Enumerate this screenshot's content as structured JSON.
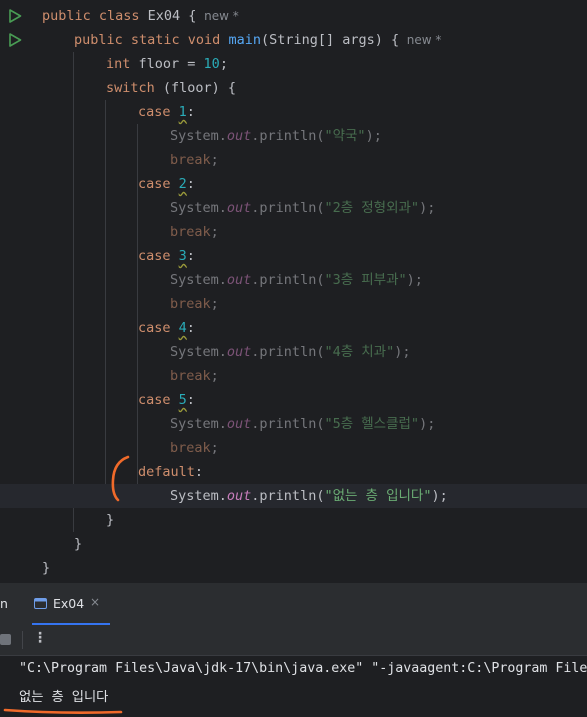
{
  "editor": {
    "lines": [
      {
        "segments": [
          {
            "t": "public class ",
            "c": "kw"
          },
          {
            "t": "Ex04 {"
          },
          {
            "t": "  new *",
            "c": "ph"
          }
        ]
      },
      {
        "segments": [
          {
            "t": "public static void ",
            "c": "kw"
          },
          {
            "t": "main",
            "c": "fn"
          },
          {
            "t": "(String[] args) {"
          },
          {
            "t": "  new *",
            "c": "ph"
          }
        ]
      },
      {
        "segments": [
          {
            "t": "int ",
            "c": "kw"
          },
          {
            "t": "floor = "
          },
          {
            "t": "10",
            "c": "num"
          },
          {
            "t": ";"
          }
        ]
      },
      {
        "segments": [
          {
            "t": "switch ",
            "c": "kw"
          },
          {
            "t": "(floor) {"
          }
        ]
      },
      {
        "segments": [
          {
            "t": "case ",
            "c": "kw"
          },
          {
            "t": "1",
            "c": "num squiggle"
          },
          {
            "t": ":"
          }
        ]
      },
      {
        "dim": true,
        "segments": [
          {
            "t": "System."
          },
          {
            "t": "out",
            "c": "fld"
          },
          {
            "t": ".println("
          },
          {
            "t": "\"약국\"",
            "c": "str"
          },
          {
            "t": ");"
          }
        ]
      },
      {
        "dim": true,
        "segments": [
          {
            "t": "break",
            "c": "kw"
          },
          {
            "t": ";"
          }
        ]
      },
      {
        "segments": [
          {
            "t": "case ",
            "c": "kw"
          },
          {
            "t": "2",
            "c": "num squiggle"
          },
          {
            "t": ":"
          }
        ]
      },
      {
        "dim": true,
        "segments": [
          {
            "t": "System."
          },
          {
            "t": "out",
            "c": "fld"
          },
          {
            "t": ".println("
          },
          {
            "t": "\"2층 정형외과\"",
            "c": "str"
          },
          {
            "t": ");"
          }
        ]
      },
      {
        "dim": true,
        "segments": [
          {
            "t": "break",
            "c": "kw"
          },
          {
            "t": ";"
          }
        ]
      },
      {
        "segments": [
          {
            "t": "case ",
            "c": "kw"
          },
          {
            "t": "3",
            "c": "num squiggle"
          },
          {
            "t": ":"
          }
        ]
      },
      {
        "dim": true,
        "segments": [
          {
            "t": "System."
          },
          {
            "t": "out",
            "c": "fld"
          },
          {
            "t": ".println("
          },
          {
            "t": "\"3층 피부과\"",
            "c": "str"
          },
          {
            "t": ");"
          }
        ]
      },
      {
        "dim": true,
        "segments": [
          {
            "t": "break",
            "c": "kw"
          },
          {
            "t": ";"
          }
        ]
      },
      {
        "segments": [
          {
            "t": "case ",
            "c": "kw"
          },
          {
            "t": "4",
            "c": "num squiggle"
          },
          {
            "t": ":"
          }
        ]
      },
      {
        "dim": true,
        "segments": [
          {
            "t": "System."
          },
          {
            "t": "out",
            "c": "fld"
          },
          {
            "t": ".println("
          },
          {
            "t": "\"4층 치과\"",
            "c": "str"
          },
          {
            "t": ");"
          }
        ]
      },
      {
        "dim": true,
        "segments": [
          {
            "t": "break",
            "c": "kw"
          },
          {
            "t": ";"
          }
        ]
      },
      {
        "segments": [
          {
            "t": "case ",
            "c": "kw"
          },
          {
            "t": "5",
            "c": "num squiggle"
          },
          {
            "t": ":"
          }
        ]
      },
      {
        "dim": true,
        "segments": [
          {
            "t": "System."
          },
          {
            "t": "out",
            "c": "fld"
          },
          {
            "t": ".println("
          },
          {
            "t": "\"5층 헬스클럽\"",
            "c": "str"
          },
          {
            "t": ");"
          }
        ]
      },
      {
        "dim": true,
        "segments": [
          {
            "t": "break",
            "c": "kw"
          },
          {
            "t": ";"
          }
        ]
      },
      {
        "segments": [
          {
            "t": "default",
            "c": "kw"
          },
          {
            "t": ":"
          }
        ]
      },
      {
        "current": true,
        "segments": [
          {
            "t": "System."
          },
          {
            "t": "out",
            "c": "fld"
          },
          {
            "t": ".println("
          },
          {
            "t": "\"없는 층 입니다\"",
            "c": "str"
          },
          {
            "t": ");"
          }
        ]
      },
      {
        "segments": [
          {
            "t": "}"
          }
        ]
      },
      {
        "segments": [
          {
            "t": "}"
          }
        ]
      },
      {
        "segments": [
          {
            "t": "}"
          }
        ]
      }
    ]
  },
  "tool_window": {
    "cut_tab_label": "n",
    "run_tab_label": "Ex04",
    "close_glyph": "×",
    "more_glyph": "⋮"
  },
  "console": {
    "command_line": "\"C:\\Program Files\\Java\\jdk-17\\bin\\java.exe\" \"-javaagent:C:\\Program File",
    "output_line": "없는 층 입니다"
  },
  "colors": {
    "background": "#1e1f22",
    "keyword": "#cf8e6d",
    "method": "#56a8f5",
    "number": "#2aacb8",
    "string": "#6aab73",
    "static_field": "#c77dbb",
    "run_gutter_icon": "#499c54",
    "annotation_marker": "#f06a2a",
    "active_tab_underline": "#3574f0"
  },
  "icons": {
    "gutter_run": "run-triangle-icon",
    "run_tab": "console-window-icon",
    "stop": "stop-icon",
    "more": "more-vertical-icon"
  }
}
